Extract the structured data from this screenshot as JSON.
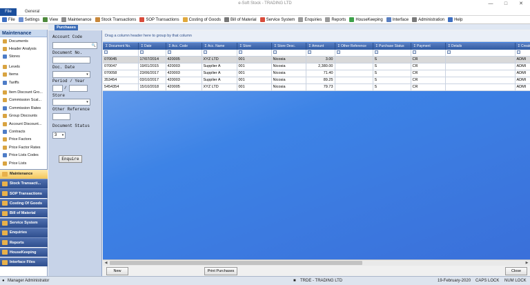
{
  "window": {
    "title": "e-Soft Stock - TRADING LTD"
  },
  "ribbon": {
    "file": "File",
    "general": "General"
  },
  "menu": [
    {
      "label": "File",
      "icon": "file-icon",
      "color": "#3e6fc1"
    },
    {
      "label": "Settings",
      "icon": "settings-icon",
      "color": "#6b8fd1"
    },
    {
      "label": "View",
      "icon": "view-icon",
      "color": "#4e8a3c"
    },
    {
      "label": "Maintenance",
      "icon": "maintenance-icon",
      "color": "#8c8c8c"
    },
    {
      "label": "Stock Transactions",
      "icon": "stock-transactions-icon",
      "color": "#c8873a"
    },
    {
      "label": "SOP Transactions",
      "icon": "sop-transactions-icon",
      "color": "#d84b3b"
    },
    {
      "label": "Costing of Goods",
      "icon": "costing-icon",
      "color": "#e0a93d"
    },
    {
      "label": "Bill of Material",
      "icon": "bill-of-material-icon",
      "color": "#777777"
    },
    {
      "label": "Service System",
      "icon": "service-system-icon",
      "color": "#d84b3b"
    },
    {
      "label": "Enquiries",
      "icon": "enquiries-icon",
      "color": "#9a9a9a"
    },
    {
      "label": "Reports",
      "icon": "reports-icon",
      "color": "#9a9a9a"
    },
    {
      "label": "HouseKeeping",
      "icon": "housekeeping-icon",
      "color": "#3ea14a"
    },
    {
      "label": "Interface",
      "icon": "interface-icon",
      "color": "#5a7fc0"
    },
    {
      "label": "Administration",
      "icon": "administration-icon",
      "color": "#7a7a7a"
    },
    {
      "label": "Help",
      "icon": "help-icon",
      "color": "#3e6fc1"
    }
  ],
  "nav": {
    "header": "Maintenance",
    "items": [
      {
        "label": "Documents",
        "sep": false
      },
      {
        "label": "Header Analysis",
        "sep": false
      },
      {
        "label": "Stores",
        "sep": false
      },
      {
        "label": "Levels",
        "sep": true
      },
      {
        "label": "Items",
        "sep": false
      },
      {
        "label": "Tariffs",
        "sep": false
      },
      {
        "label": "Item Discount Gro...",
        "sep": true
      },
      {
        "label": "Commission Scal...",
        "sep": false
      },
      {
        "label": "Commission Rates",
        "sep": false
      },
      {
        "label": "Group Discounts",
        "sep": false
      },
      {
        "label": "Account Discount...",
        "sep": false
      },
      {
        "label": "Contracts",
        "sep": false
      },
      {
        "label": "Price Factors",
        "sep": false
      },
      {
        "label": "Price Factor Rates",
        "sep": false
      },
      {
        "label": "Price Lists Codes",
        "sep": false
      },
      {
        "label": "Price Lists",
        "sep": false
      }
    ],
    "groups": [
      {
        "label": "Maintenance",
        "active": true
      },
      {
        "label": "Stock Transacti...",
        "active": false
      },
      {
        "label": "SOP Transactions",
        "active": false
      },
      {
        "label": "Costing Of Goods",
        "active": false
      },
      {
        "label": "Bill of Material",
        "active": false
      },
      {
        "label": "Service System",
        "active": false
      },
      {
        "label": "Enquiries",
        "active": false
      },
      {
        "label": "Reports",
        "active": false
      },
      {
        "label": "HouseKeeping",
        "active": false
      },
      {
        "label": "Interface Files",
        "active": false
      }
    ]
  },
  "doc_tab": "Purchases",
  "filter": {
    "account_code": "Account Code",
    "document_no": "Document No.",
    "doc_date": "Doc. Date",
    "period_year": "Period / Year",
    "period_sep": "/",
    "store": "Store",
    "other_reference": "Other Reference",
    "document_status": "Document Status",
    "document_status_value": "3",
    "enquire": "Enquire"
  },
  "grid": {
    "group_hint": "Drag a column header here to group by that column",
    "columns": [
      "Document No.",
      "Date",
      "Acc. Code",
      "Acc. Name",
      "Store",
      "Store Desc.",
      "Amount",
      "Other Reference",
      "Purchase Status",
      "Payment",
      "Details",
      "Created"
    ],
    "rows": [
      [
        "070045",
        "17/07/2014",
        "420005",
        "XYZ LTD",
        "001",
        "Nicosia",
        "3.00",
        "",
        "S",
        "CR",
        "",
        "ADMI"
      ],
      [
        "070047",
        "19/01/2015",
        "420003",
        "Supplier A",
        "001",
        "Nicosia",
        "2,380.00",
        "",
        "S",
        "CR",
        "",
        "ADMI"
      ],
      [
        "070058",
        "23/06/2017",
        "420003",
        "Supplier A",
        "001",
        "Nicosia",
        "71.40",
        "",
        "S",
        "CR",
        "",
        "ADMI"
      ],
      [
        "353454",
        "03/10/2017",
        "420003",
        "Supplier A",
        "001",
        "Nicosia",
        "89.25",
        "",
        "S",
        "CR",
        "",
        "ADMI"
      ],
      [
        "5454354",
        "15/10/2018",
        "420005",
        "XYZ LTD",
        "001",
        "Nicosia",
        "79.73",
        "",
        "S",
        "CR",
        "",
        "ADMI"
      ]
    ]
  },
  "buttons": {
    "new": "New",
    "print": "Print Purchases",
    "close": "Close"
  },
  "status": {
    "user": "Manager Administrator",
    "company": "TRDE - TRADING LTD",
    "date": "19-February-2020",
    "caps": "CAPS LOCK",
    "num": "NUM LOCK"
  }
}
